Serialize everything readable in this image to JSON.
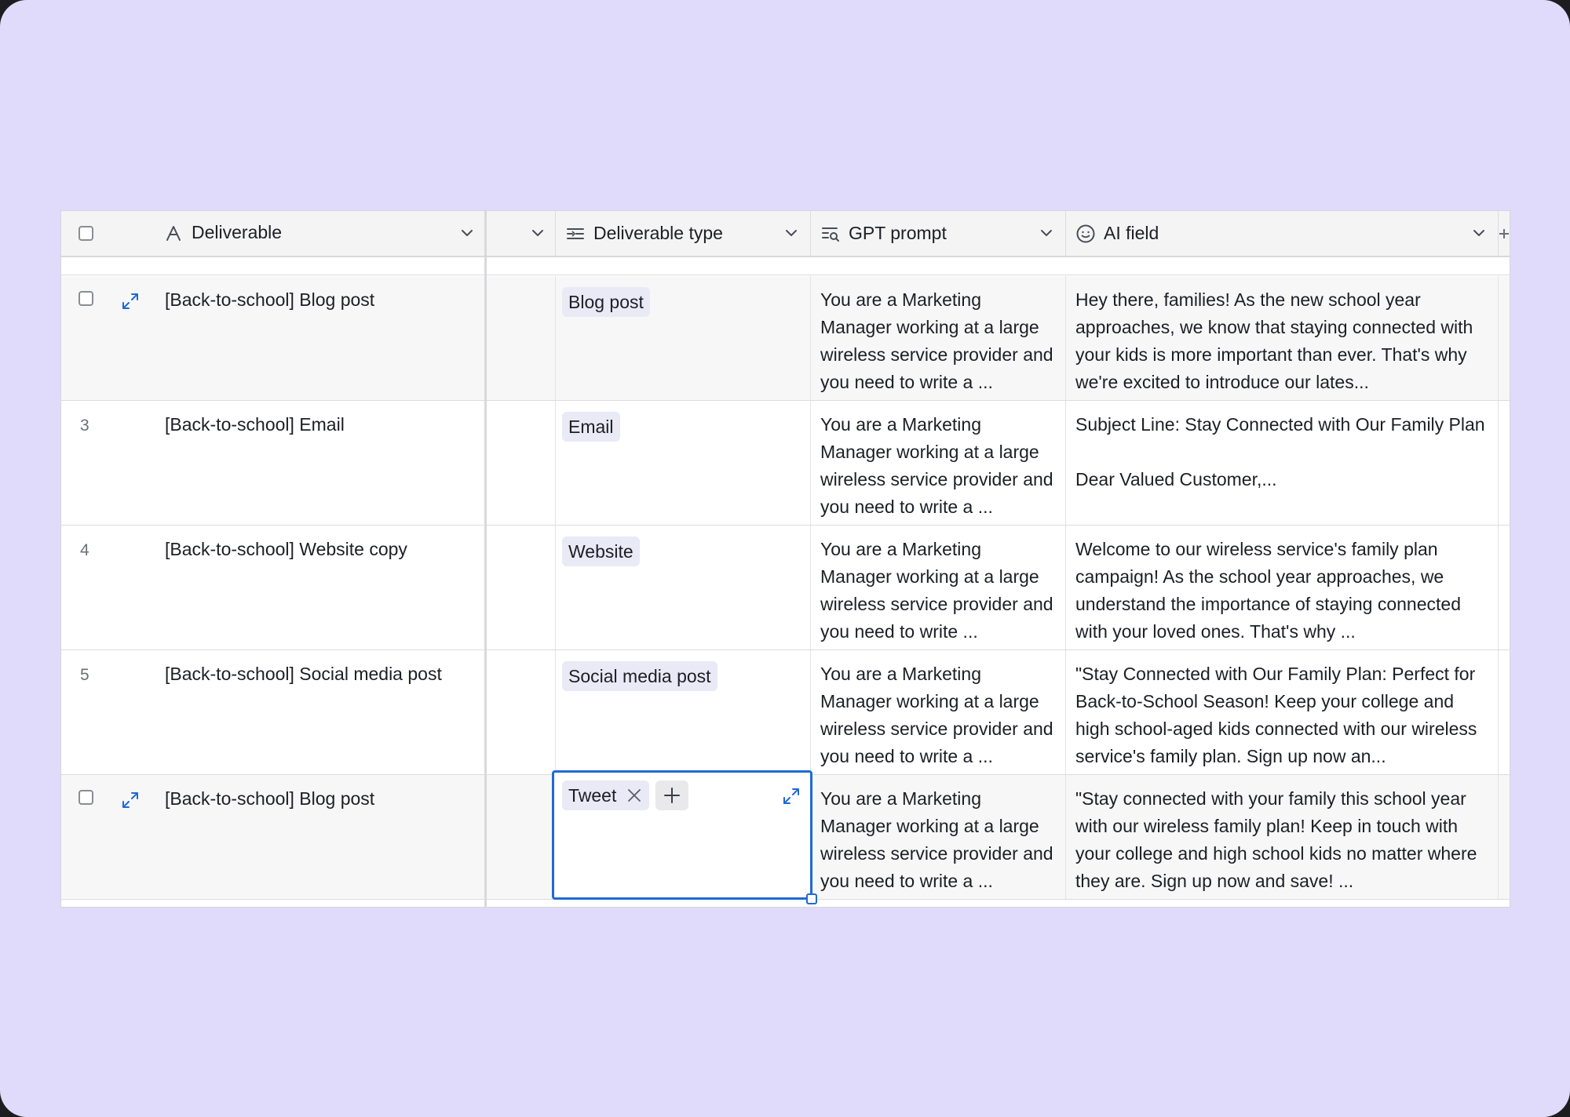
{
  "header": {
    "deliverable": "Deliverable",
    "deliverable_type": "Deliverable type",
    "gpt_prompt": "GPT prompt",
    "ai_field": "AI field"
  },
  "rows": [
    {
      "number": "",
      "deliverable": "[Back-to-school] Blog post",
      "type": "Blog post",
      "gpt": "You are a Marketing Manager working at a large wireless service provider and you need to write a ...",
      "ai": "Hey there, families! As the new school year approaches, we know that staying connected with your kids is more important than ever. That's why we're excited to introduce our lates..."
    },
    {
      "number": "3",
      "deliverable": "[Back-to-school] Email",
      "type": "Email",
      "gpt": "You are a Marketing Manager working at a large wireless service provider and you need to write a ...",
      "ai": "Subject Line: Stay Connected with Our Family Plan\n\nDear Valued Customer,..."
    },
    {
      "number": "4",
      "deliverable": "[Back-to-school] Website copy",
      "type": "Website",
      "gpt": "You are a Marketing Manager working at a large wireless service provider and you need to write ...",
      "ai": "Welcome to our wireless service's family plan campaign! As the school year approaches, we understand the importance of staying connected with your loved ones. That's why ..."
    },
    {
      "number": "5",
      "deliverable": "[Back-to-school] Social media post",
      "type": "Social media post",
      "gpt": "You are a Marketing Manager working at a large wireless service provider and you need to write a ...",
      "ai": "\"Stay Connected with Our Family Plan: Perfect for Back-to-School Season! Keep your college and high school-aged kids connected with our wireless service's family plan. Sign up now an..."
    },
    {
      "number": "",
      "deliverable": "[Back-to-school] Blog post",
      "type": "Tweet",
      "gpt": "You are a Marketing Manager working at a large wireless service provider and you need to write a ...",
      "ai": "\"Stay connected with your family this school year with our wireless family plan! Keep in touch with your college and high school kids no matter where they are. Sign up now and save! ..."
    }
  ],
  "colors": {
    "background": "#e0dafb",
    "selection": "#1f6ad4",
    "pill": "#e9eaf6"
  }
}
